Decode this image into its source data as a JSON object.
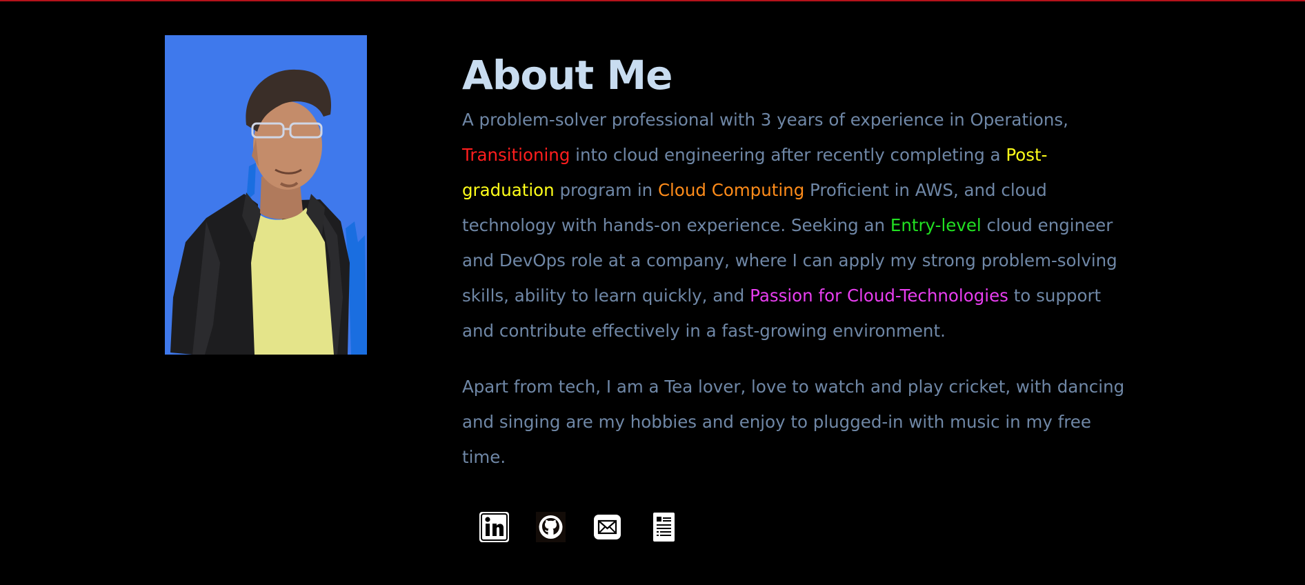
{
  "about": {
    "title": "About Me",
    "paragraph1": [
      {
        "text": "A problem-solver professional with 3 years of experience in Operations, ",
        "color": "#6f87a6"
      },
      {
        "text": "Transitioning",
        "color": "#ff1e1e"
      },
      {
        "text": " into cloud engineering after recently completing a ",
        "color": "#6f87a6"
      },
      {
        "text": "Post-graduation",
        "color": "#ffff1a"
      },
      {
        "text": " program in ",
        "color": "#6f87a6"
      },
      {
        "text": "Cloud Computing",
        "color": "#ff8c1a"
      },
      {
        "text": " Proficient in AWS, and cloud technology with hands-on experience. Seeking an ",
        "color": "#6f87a6"
      },
      {
        "text": "Entry-level",
        "color": "#22e022"
      },
      {
        "text": " cloud engineer and DevOps role at a company, where I can apply my strong problem-solving skills, ability to learn quickly, and ",
        "color": "#6f87a6"
      },
      {
        "text": "Passion for Cloud-Technologies",
        "color": "#e83ef0"
      },
      {
        "text": " to support and contribute effectively in a fast-growing environment.",
        "color": "#6f87a6"
      }
    ],
    "paragraph2": "Apart from tech, I am a Tea lover, love to watch and play cricket, with dancing and singing are my hobbies and enjoy to plugged-in with music in my free time."
  },
  "socials": [
    {
      "name": "linkedin-icon"
    },
    {
      "name": "github-icon"
    },
    {
      "name": "email-icon"
    },
    {
      "name": "resume-icon"
    }
  ],
  "colors": {
    "background": "#000000",
    "heading": "#c8dcf0",
    "body_text": "#6f87a6",
    "photo_background": "#3f79ec",
    "top_line": "#b5121b"
  }
}
